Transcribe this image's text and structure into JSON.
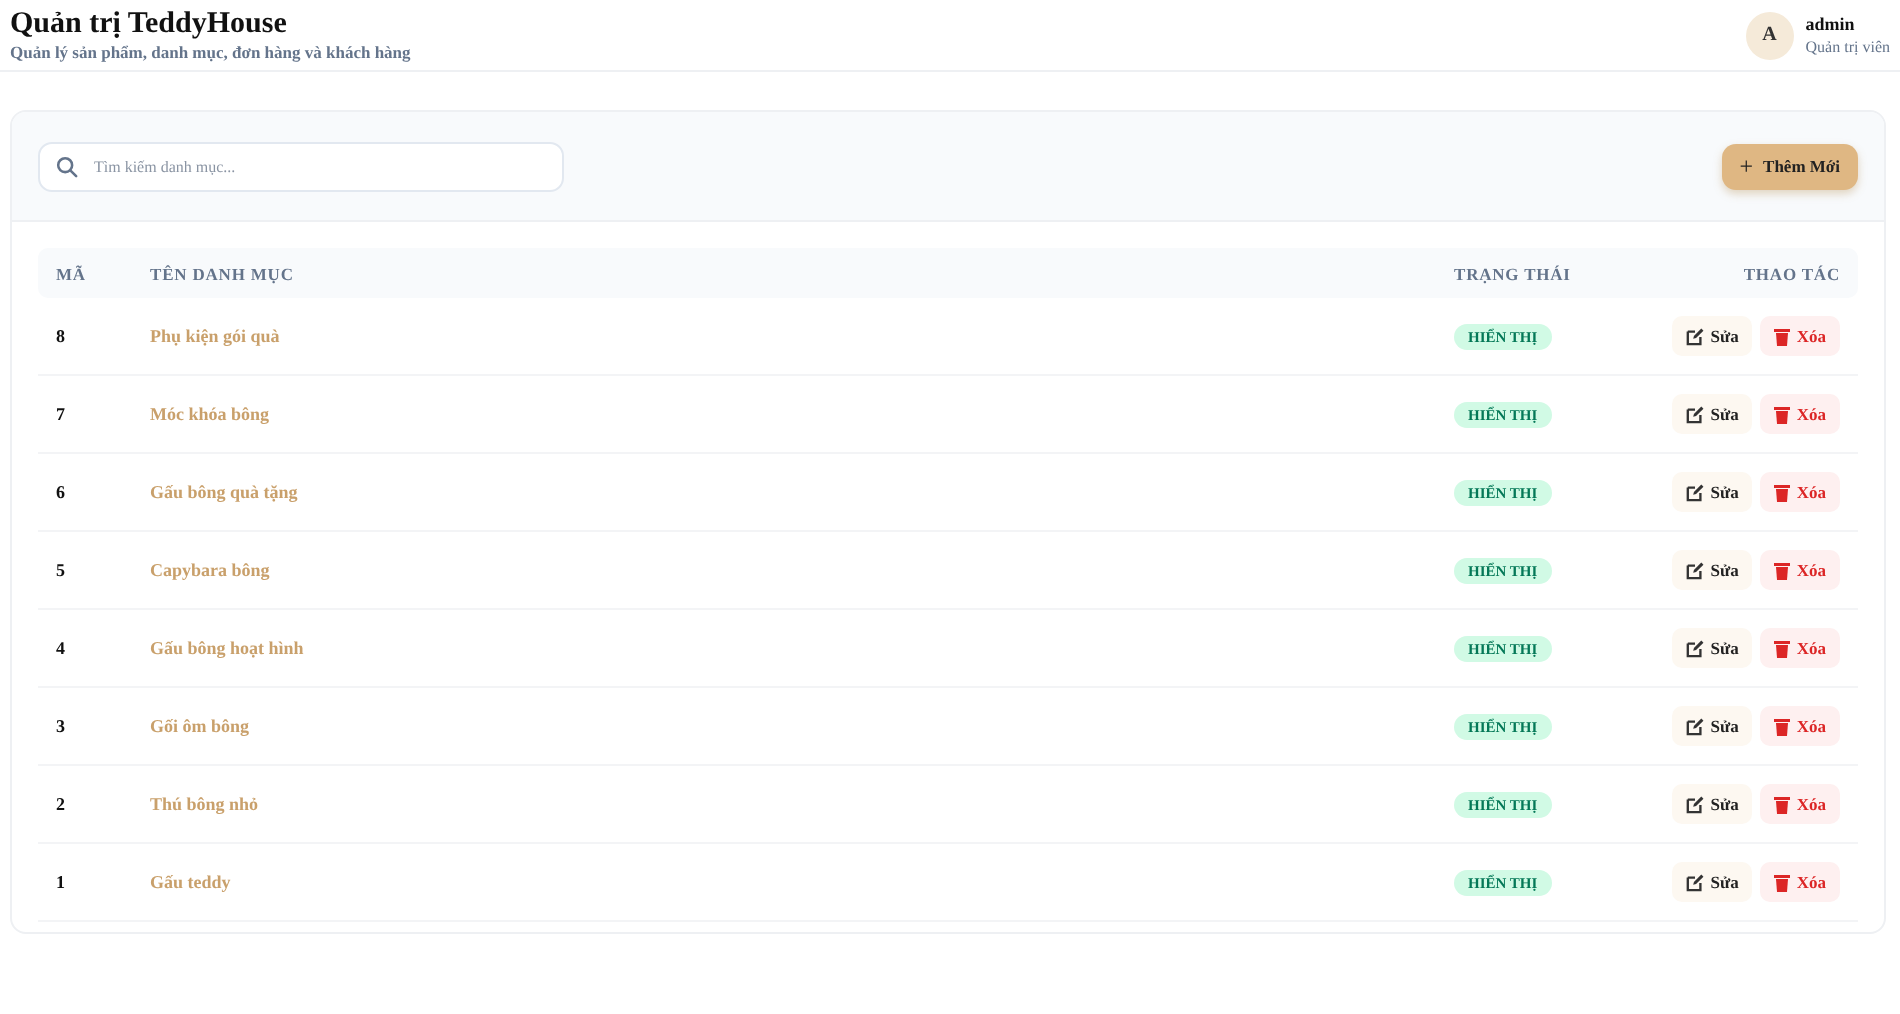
{
  "header": {
    "title": "Quản trị TeddyHouse",
    "subtitle": "Quản lý sản phẩm, danh mục, đơn hàng và khách hàng",
    "user": {
      "avatar": "A",
      "name": "admin",
      "role": "Quản trị viên"
    }
  },
  "toolbar": {
    "search": {
      "placeholder": "Tìm kiếm danh mục..."
    },
    "add_button": {
      "icon": "+",
      "label": "Thêm Mới"
    }
  },
  "table": {
    "columns": [
      "MÃ",
      "TÊN DANH MỤC",
      "TRẠNG THÁI",
      "THAO TÁC"
    ],
    "rows": [
      {
        "id": "8",
        "name": "Phụ kiện gói quà",
        "status": "HIỂN THỊ",
        "visible": true,
        "edit": "Sửa",
        "delete": "Xóa"
      },
      {
        "id": "7",
        "name": "Móc khóa bông",
        "status": "HIỂN THỊ",
        "visible": true,
        "edit": "Sửa",
        "delete": "Xóa"
      },
      {
        "id": "6",
        "name": "Gấu bông quà tặng",
        "status": "HIỂN THỊ",
        "visible": true,
        "edit": "Sửa",
        "delete": "Xóa"
      },
      {
        "id": "5",
        "name": "Capybara bông",
        "status": "HIỂN THỊ",
        "visible": true,
        "edit": "Sửa",
        "delete": "Xóa"
      },
      {
        "id": "4",
        "name": "Gấu bông hoạt hình",
        "status": "HIỂN THỊ",
        "visible": true,
        "edit": "Sửa",
        "delete": "Xóa"
      },
      {
        "id": "3",
        "name": "Gối ôm bông",
        "status": "HIỂN THỊ",
        "visible": true,
        "edit": "Sửa",
        "delete": "Xóa"
      },
      {
        "id": "2",
        "name": "Thú bông nhỏ",
        "status": "HIỂN THỊ",
        "visible": true,
        "edit": "Sửa",
        "delete": "Xóa"
      },
      {
        "id": "1",
        "name": "Gấu teddy",
        "status": "HIỂN THỊ",
        "visible": true,
        "edit": "Sửa",
        "delete": "Xóa"
      }
    ]
  }
}
